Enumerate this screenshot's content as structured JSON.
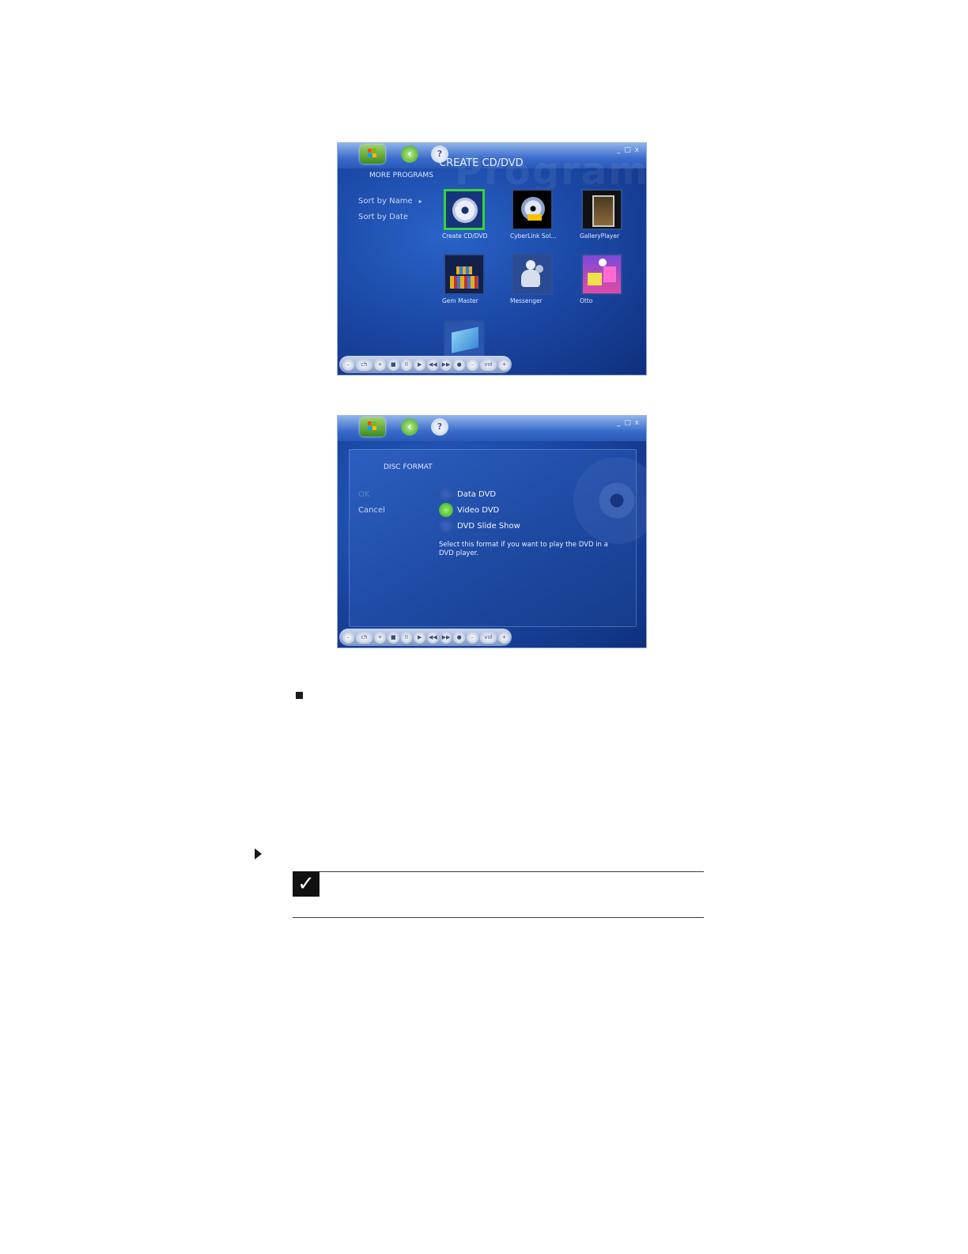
{
  "screen1": {
    "title": "CREATE CD/DVD",
    "watermark": "Programs",
    "section": "MORE PROGRAMS",
    "window_controls": "_ □ x",
    "sort": {
      "by_name": "Sort by Name",
      "arrow": "▸",
      "by_date": "Sort by Date"
    },
    "tiles": [
      {
        "label": "Create CD/DVD",
        "icon": "cd-icon"
      },
      {
        "label": "CyberLink Sol...",
        "icon": "dvd-software-icon"
      },
      {
        "label": "GalleryPlayer",
        "icon": "gallery-frame-icon"
      },
      {
        "label": "Gem Master",
        "icon": "gem-game-icon"
      },
      {
        "label": "Messenger",
        "icon": "messenger-icon"
      },
      {
        "label": "Otto",
        "icon": "otto-game-icon"
      },
      {
        "label": "",
        "icon": "program-tile-icon"
      }
    ]
  },
  "screen2": {
    "section": "DISC FORMAT",
    "window_controls": "_ □ x",
    "left_options": {
      "ok": "OK",
      "cancel": "Cancel"
    },
    "formats": [
      {
        "label": "Data DVD",
        "selected": false
      },
      {
        "label": "Video DVD",
        "selected": true
      },
      {
        "label": "DVD Slide Show",
        "selected": false
      }
    ],
    "description": "Select this format if you want to play the DVD in a DVD player."
  },
  "transport": {
    "buttons": [
      "–",
      "ch",
      "+",
      "■",
      "II",
      "▶",
      "◀◀",
      "▶▶",
      "●",
      "–",
      "vol",
      "+"
    ]
  },
  "note": {
    "check": "✓"
  },
  "colors": {
    "accent_green": "#3ad23a",
    "screen_blue": "#1c4aa8"
  }
}
